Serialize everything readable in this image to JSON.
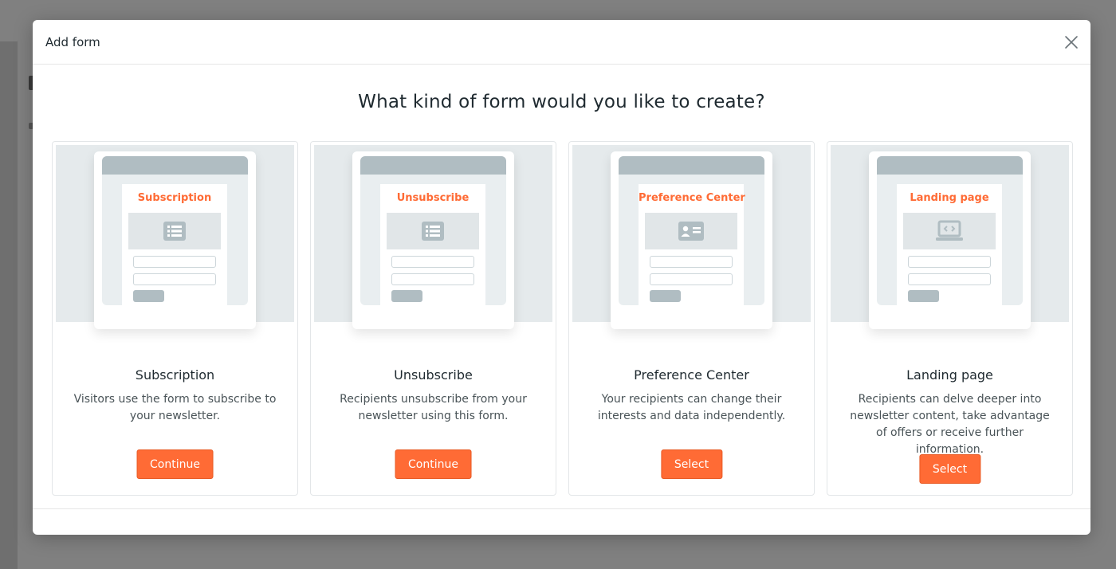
{
  "modal": {
    "title": "Add form",
    "question": "What kind of form would you like to create?"
  },
  "colors": {
    "accent": "#ff6b35",
    "mock_gray": "#b0bdc2",
    "preview_bg": "#e5eaec"
  },
  "cards": [
    {
      "preview_label": "Subscription",
      "preview_icon": "list-icon",
      "title": "Subscription",
      "description": "Visitors use the form to subscribe to your newsletter.",
      "button": "Continue"
    },
    {
      "preview_label": "Unsubscribe",
      "preview_icon": "list-icon",
      "title": "Unsubscribe",
      "description": "Recipients unsubscribe from your newsletter using this form.",
      "button": "Continue"
    },
    {
      "preview_label": "Preference Center",
      "preview_icon": "contact-card-icon",
      "title": "Preference Center",
      "description": "Your recipients can change their interests and data independently.",
      "button": "Select"
    },
    {
      "preview_label": "Landing page",
      "preview_icon": "laptop-code-icon",
      "title": "Landing page",
      "description": "Recipients can delve deeper into newsletter content, take advantage of offers or receive further information.",
      "button": "Select"
    }
  ]
}
